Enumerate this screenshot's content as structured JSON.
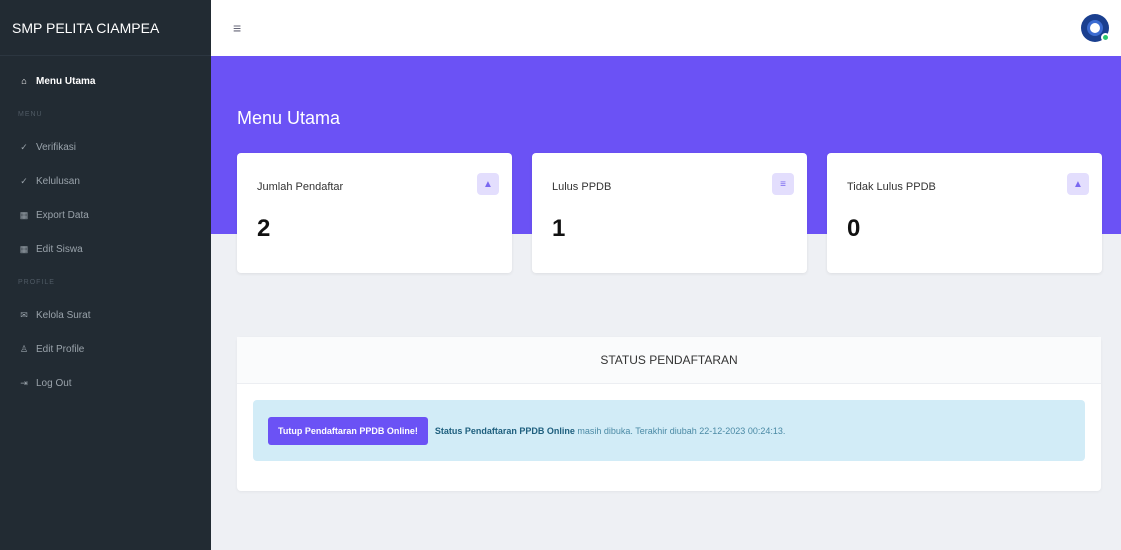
{
  "app": {
    "brand": "SMP PELITA CIAMPEA"
  },
  "sidebar": {
    "items": [
      {
        "label": "Menu Utama",
        "icon": "home-icon"
      },
      {
        "label": "MENU",
        "type": "section"
      },
      {
        "label": "Verifikasi",
        "icon": "check-icon"
      },
      {
        "label": "Kelulusan",
        "icon": "check-icon"
      },
      {
        "label": "Export Data",
        "icon": "grid-icon"
      },
      {
        "label": "Edit Siswa",
        "icon": "grid-icon"
      },
      {
        "label": "PROFILE",
        "type": "section"
      },
      {
        "label": "Kelola Surat",
        "icon": "mail-icon"
      },
      {
        "label": "Edit Profile",
        "icon": "user-icon"
      },
      {
        "label": "Log Out",
        "icon": "logout-icon"
      }
    ]
  },
  "topbar": {
    "menu_icon": "hamburger-icon",
    "avatar_icon": "avatar-icon"
  },
  "page": {
    "title": "Menu Utama"
  },
  "stats": [
    {
      "label": "Jumlah Pendaftar",
      "value": "2",
      "icon": "users-icon"
    },
    {
      "label": "Lulus PPDB",
      "value": "1",
      "icon": "list-icon"
    },
    {
      "label": "Tidak Lulus PPDB",
      "value": "0",
      "icon": "users-icon"
    }
  ],
  "status": {
    "heading": "STATUS PENDAFTARAN",
    "button_label": "Tutup Pendaftaran PPDB Online!",
    "status_strong": "Status Pendaftaran PPDB Online",
    "status_text": " masih dibuka. Terakhir diubah 22-12-2023 00:24:13."
  },
  "colors": {
    "accent": "#6b52f5",
    "sidebar": "#222b33",
    "alert": "#d2ecf7"
  }
}
